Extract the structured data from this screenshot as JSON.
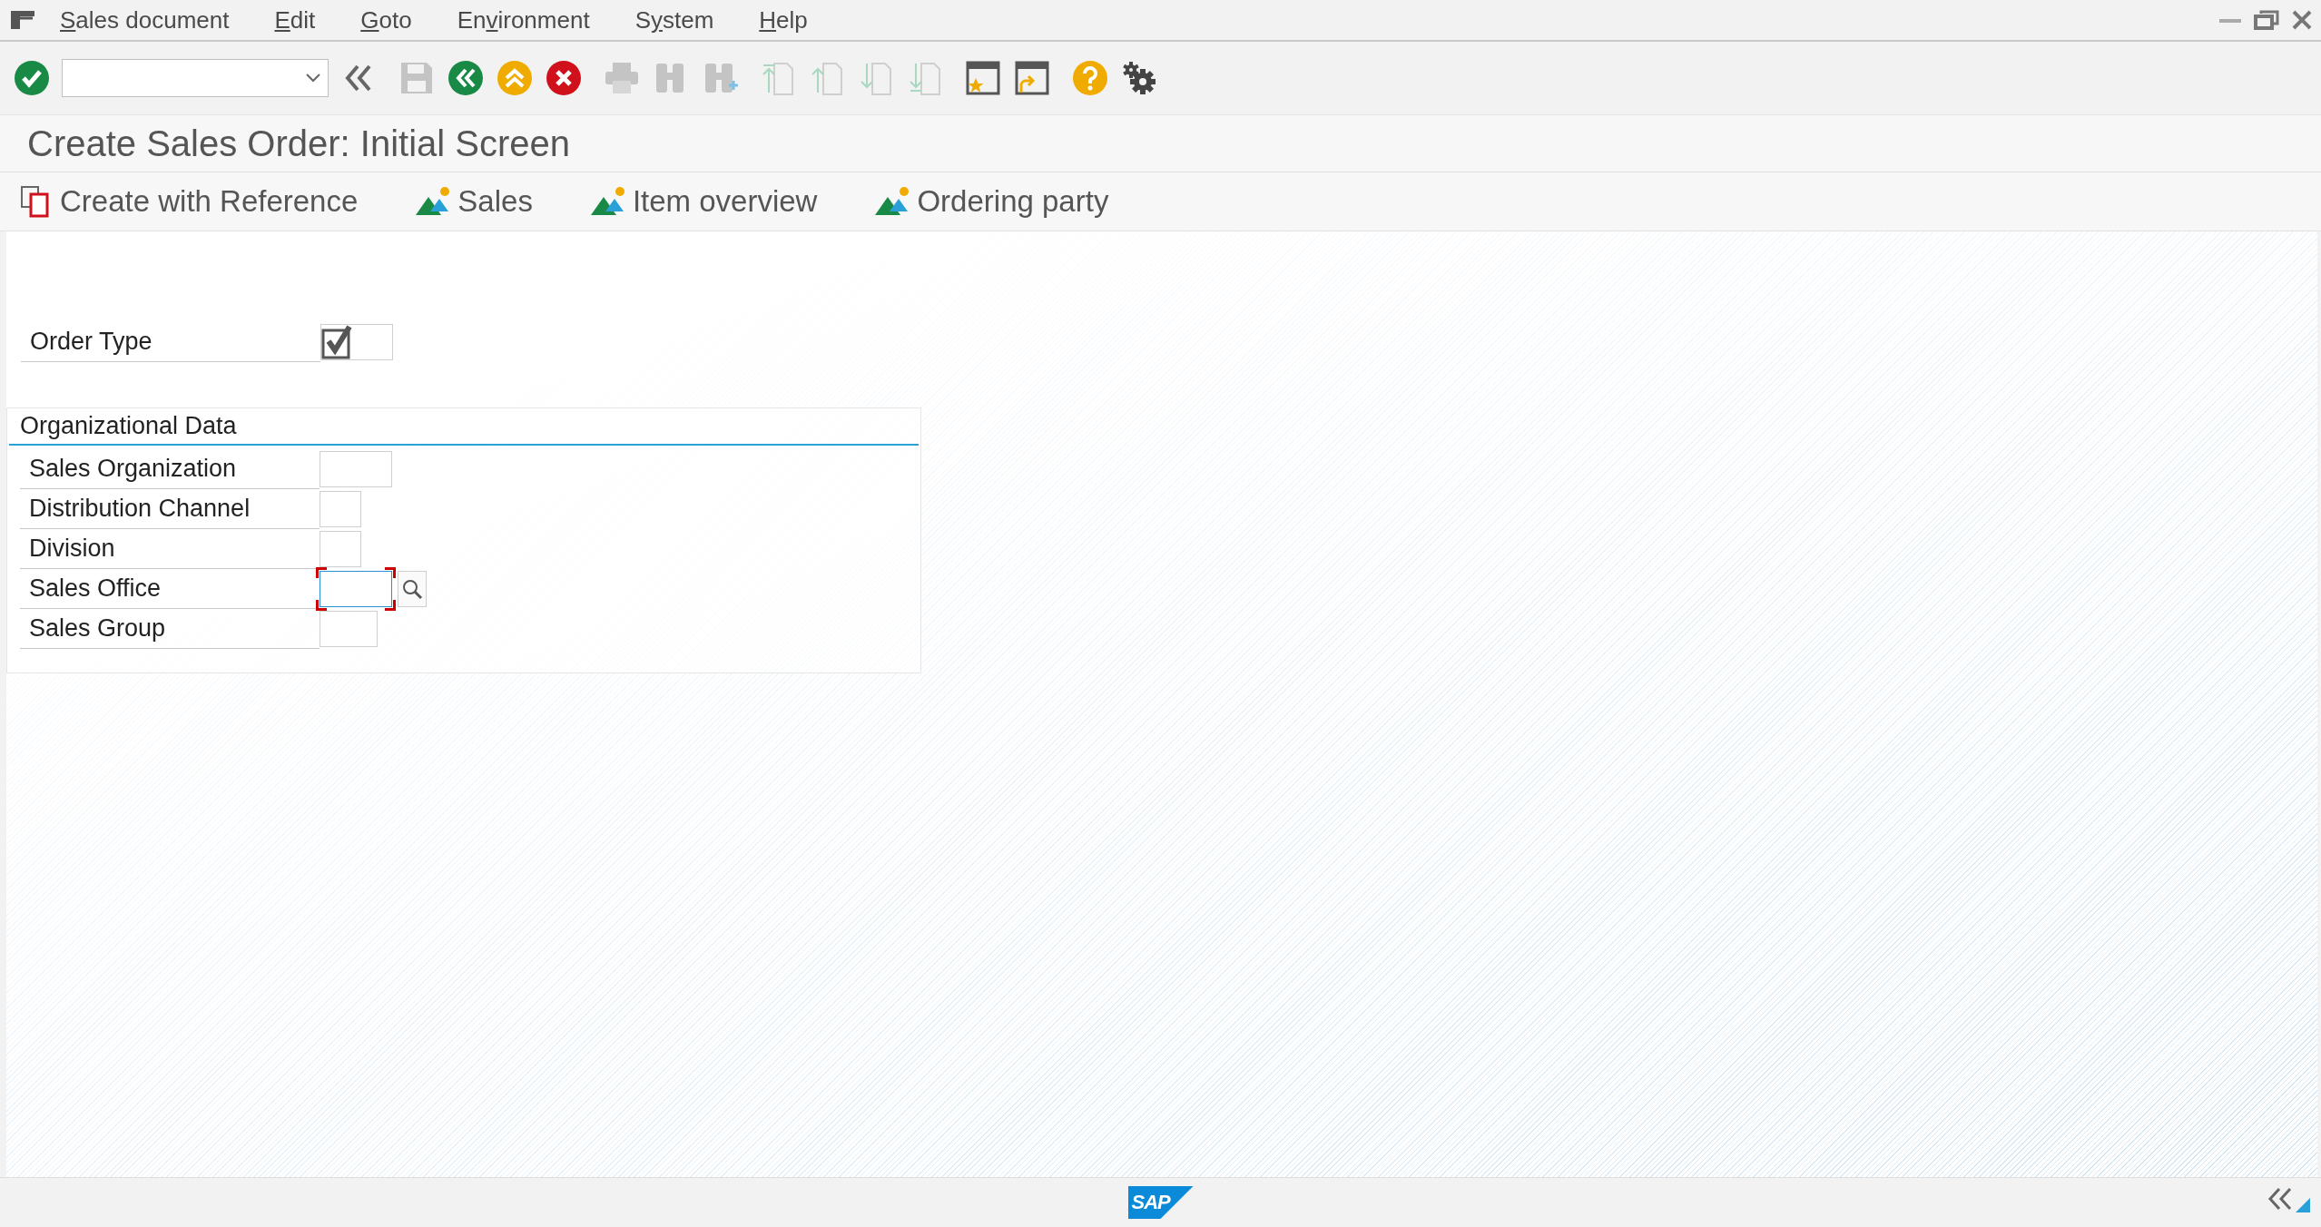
{
  "menu_bar": {
    "items": [
      {
        "key": "S",
        "post": "ales document"
      },
      {
        "key": "E",
        "post": "dit"
      },
      {
        "key": "G",
        "post": "oto"
      },
      {
        "pre": "En",
        "key": "v",
        "post": "ironment"
      },
      {
        "pre": "S",
        "key": "y",
        "post": "stem"
      },
      {
        "key": "H",
        "post": "elp"
      }
    ]
  },
  "toolbar": {
    "groups": [
      [
        {
          "kind": "enter",
          "disabled": false
        },
        {
          "kind": "command_field",
          "disabled": false
        },
        {
          "kind": "collapse",
          "disabled": false
        }
      ],
      [
        {
          "kind": "save",
          "disabled": true
        },
        {
          "kind": "back",
          "disabled": false
        },
        {
          "kind": "exit",
          "disabled": false
        },
        {
          "kind": "cancel",
          "disabled": false
        }
      ],
      [
        {
          "kind": "print",
          "disabled": true
        },
        {
          "kind": "find",
          "disabled": true
        },
        {
          "kind": "find_next",
          "disabled": true
        }
      ],
      [
        {
          "kind": "first_page",
          "disabled": true
        },
        {
          "kind": "previous_page",
          "disabled": true
        },
        {
          "kind": "next_page",
          "disabled": true
        },
        {
          "kind": "last_page",
          "disabled": true
        }
      ],
      [
        {
          "kind": "new_session",
          "disabled": false
        },
        {
          "kind": "shortcut",
          "disabled": false
        }
      ],
      [
        {
          "kind": "help",
          "disabled": false
        },
        {
          "kind": "settings",
          "disabled": false
        }
      ]
    ]
  },
  "title": "Create Sales Order: Initial Screen",
  "app_toolbar": {
    "buttons": [
      {
        "kind": "reference",
        "label": "Create with Reference"
      },
      {
        "kind": "navigate",
        "label": "Sales"
      },
      {
        "kind": "navigate",
        "label": "Item overview"
      },
      {
        "kind": "navigate",
        "label": "Ordering party"
      }
    ]
  },
  "order_type": {
    "label": "Order Type",
    "required": true,
    "focused": false
  },
  "organizational_data": {
    "title": "Organizational Data",
    "fields": [
      {
        "label": "Sales Organization",
        "kind": "long",
        "focused": false,
        "value_help": false
      },
      {
        "label": "Distribution Channel",
        "kind": "short",
        "focused": false,
        "value_help": false
      },
      {
        "label": "Division",
        "kind": "short",
        "focused": false,
        "value_help": false
      },
      {
        "label": "Sales Office",
        "kind": "long",
        "focused": true,
        "value_help": true
      },
      {
        "label": "Sales Group",
        "kind": "medium",
        "focused": false,
        "value_help": false
      }
    ]
  },
  "footer": {
    "logo_text": "SAP"
  }
}
